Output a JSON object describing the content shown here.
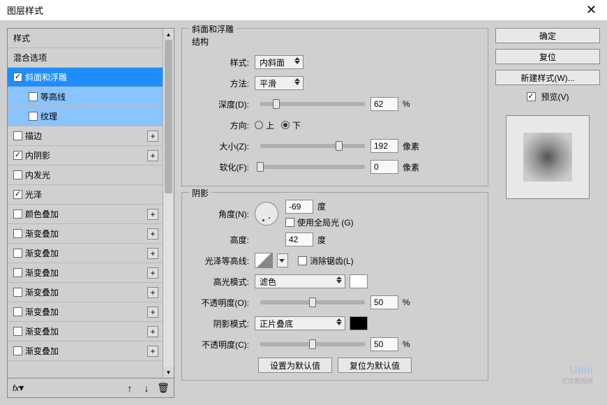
{
  "title": "图层样式",
  "left": {
    "header_style": "样式",
    "header_blend": "混合选项",
    "items": [
      {
        "label": "斜面和浮雕",
        "checked": true,
        "selected": true
      },
      {
        "label": "等高线",
        "checked": false,
        "indent": true,
        "sub": true
      },
      {
        "label": "纹理",
        "checked": false,
        "indent": true,
        "sub": true
      },
      {
        "label": "描边",
        "checked": false,
        "add": true
      },
      {
        "label": "内阴影",
        "checked": true,
        "add": true
      },
      {
        "label": "内发光",
        "checked": false
      },
      {
        "label": "光泽",
        "checked": true
      },
      {
        "label": "颜色叠加",
        "checked": false,
        "add": true
      },
      {
        "label": "渐变叠加",
        "checked": false,
        "add": true
      },
      {
        "label": "渐变叠加",
        "checked": false,
        "add": true
      },
      {
        "label": "渐变叠加",
        "checked": false,
        "add": true
      },
      {
        "label": "渐变叠加",
        "checked": false,
        "add": true
      },
      {
        "label": "渐变叠加",
        "checked": false,
        "add": true
      },
      {
        "label": "渐变叠加",
        "checked": false,
        "add": true
      },
      {
        "label": "渐变叠加",
        "checked": false,
        "add": true
      }
    ]
  },
  "center": {
    "section1_title": "斜面和浮雕",
    "structure_label": "结构",
    "style_label": "样式:",
    "style_value": "内斜面",
    "method_label": "方法:",
    "method_value": "平滑",
    "depth_label": "深度(D):",
    "depth_value": "62",
    "percent": "%",
    "direction_label": "方向:",
    "dir_up": "上",
    "dir_down": "下",
    "size_label": "大小(Z):",
    "size_value": "192",
    "px": "像素",
    "soften_label": "软化(F):",
    "soften_value": "0",
    "section2_title": "阴影",
    "angle_label": "角度(N):",
    "angle_value": "-69",
    "deg": "度",
    "global_light": "使用全局光 (G)",
    "altitude_label": "高度:",
    "altitude_value": "42",
    "gloss_contour_label": "光泽等高线:",
    "antialias": "消除锯齿(L)",
    "highlight_mode_label": "高光模式:",
    "highlight_mode_value": "滤色",
    "highlight_color": "#ffffff",
    "highlight_opacity_label": "不透明度(O):",
    "highlight_opacity_value": "50",
    "shadow_mode_label": "阴影模式:",
    "shadow_mode_value": "正片叠底",
    "shadow_color": "#000000",
    "shadow_opacity_label": "不透明度(C):",
    "shadow_opacity_value": "50",
    "btn_default": "设置为默认值",
    "btn_reset": "复位为默认值"
  },
  "right": {
    "ok": "确定",
    "cancel": "复位",
    "new_style": "新建样式(W)...",
    "preview": "预览(V)"
  },
  "watermark": "Uiiiii",
  "watermark_sub": "优优教程网"
}
